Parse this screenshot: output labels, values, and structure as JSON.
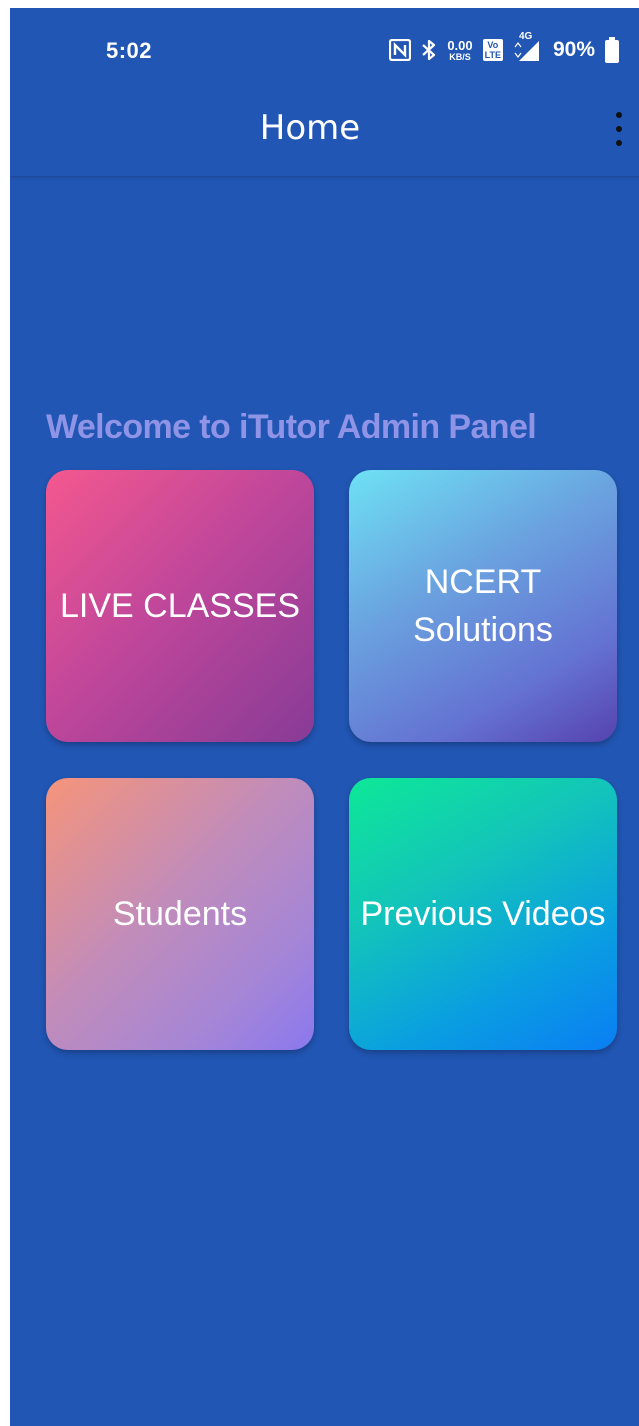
{
  "status_bar": {
    "time": "5:02",
    "speed_value": "0.00",
    "speed_unit": "KB/S",
    "volte_top": "Vo",
    "volte_bottom": "LTE",
    "network": "4G",
    "battery": "90%",
    "icons": [
      "nfc-icon",
      "bluetooth-icon",
      "volte-icon",
      "signal-icon",
      "battery-icon"
    ]
  },
  "app_bar": {
    "title": "Home",
    "menu_icon": "more-vert-icon"
  },
  "main": {
    "welcome": "Welcome to iTutor Admin Panel",
    "tiles": [
      {
        "label": "LIVE CLASSES"
      },
      {
        "label": "NCERT\nSolutions"
      },
      {
        "label": "Students"
      },
      {
        "label": "Previous Videos"
      }
    ]
  },
  "colors": {
    "background": "#2156b4",
    "welcome_text": "#8f94e6",
    "tile_text": "#ffffff"
  }
}
